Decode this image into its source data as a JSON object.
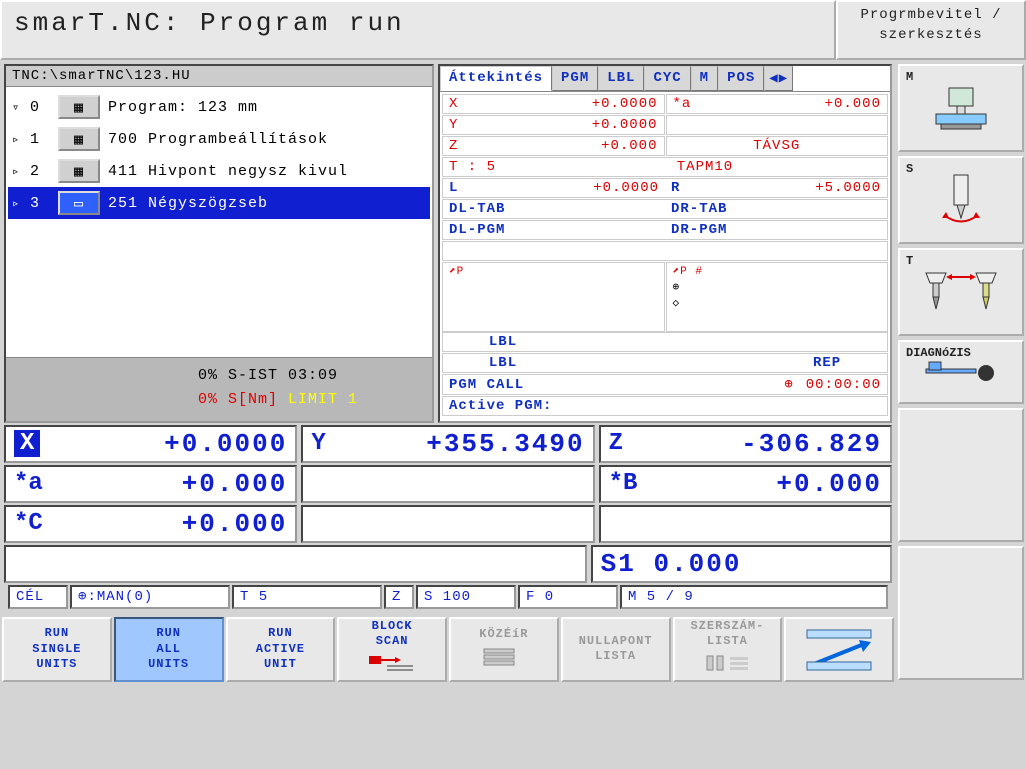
{
  "header": {
    "title": "smarT.NC: Program run",
    "mode": "Progrmbevitel / szerkesztés"
  },
  "path": "TNC:\\smarTNC\\123.HU",
  "tree": [
    {
      "exp": "▿",
      "idx": "0",
      "txt": "Program: 123 mm",
      "sel": false
    },
    {
      "exp": "▹",
      "idx": "1",
      "txt": "700 Programbeállítások",
      "sel": false
    },
    {
      "exp": "▹",
      "idx": "2",
      "txt": "411 Hivpont negysz kivul",
      "sel": false
    },
    {
      "exp": "▹",
      "idx": "3",
      "txt": "251 Négyszögzseb",
      "sel": true
    }
  ],
  "status": {
    "l1": "0% S-IST 03:09",
    "l2a": "0% S[Nm]",
    "l2b": "LIMIT 1"
  },
  "tabs": [
    "Áttekintés",
    "PGM",
    "LBL",
    "CYC",
    "M",
    "POS"
  ],
  "info": {
    "xyz": [
      {
        "k": "X",
        "v": "+0.0000"
      },
      {
        "k": "Y",
        "v": "+0.0000"
      },
      {
        "k": "Z",
        "v": "+0.000"
      }
    ],
    "aa": {
      "k": "*a",
      "v": "+0.000"
    },
    "tavsg": "TÁVSG",
    "tool": {
      "t": "T : 5",
      "name": "TAPM10",
      "L": "L",
      "Lv": "+0.0000",
      "R": "R",
      "Rv": "+5.0000"
    },
    "dl": [
      "DL-TAB",
      "DL-PGM"
    ],
    "dr": [
      "DR-TAB",
      "DR-PGM"
    ],
    "lbl1": "LBL",
    "lbl2": "LBL",
    "rep": "REP",
    "pgmcall": "PGM CALL",
    "time": "00:00:00",
    "active": "Active PGM:"
  },
  "dro": {
    "r1": [
      {
        "ax": "X",
        "v": "+0.0000"
      },
      {
        "ax": "Y",
        "v": "+355.3490"
      },
      {
        "ax": "Z",
        "v": "-306.829"
      }
    ],
    "r2": [
      {
        "ax": "*a",
        "v": "+0.000"
      },
      {
        "ax": "",
        "v": ""
      },
      {
        "ax": "*B",
        "v": "+0.000"
      }
    ],
    "r3": [
      {
        "ax": "*C",
        "v": "+0.000"
      }
    ],
    "s1": "S1  0.000",
    "status": {
      "cel": "CÉL",
      "man": ":MAN(0)",
      "t": "T 5",
      "z": "Z",
      "s": "S 100",
      "f": "F 0",
      "m": "M 5 / 9"
    }
  },
  "sidebar": {
    "m": "M",
    "s": "S",
    "t": "T",
    "diag": "DIAGNóZIS"
  },
  "softkeys": [
    {
      "l": "RUN\nSINGLE\nUNITS"
    },
    {
      "l": "RUN\nALL\nUNITS",
      "act": true
    },
    {
      "l": "RUN\nACTIVE\nUNIT"
    },
    {
      "l": "BLOCK\nSCAN",
      "ico": true
    },
    {
      "l": "KÖZÉíR",
      "dis": true,
      "ico2": true
    },
    {
      "l": "NULLAPONT\nLISTA",
      "dis": true
    },
    {
      "l": "SZERSZÁM-\nLISTA",
      "dis": true,
      "ico3": true
    },
    {
      "l": "",
      "arrow": true
    }
  ]
}
